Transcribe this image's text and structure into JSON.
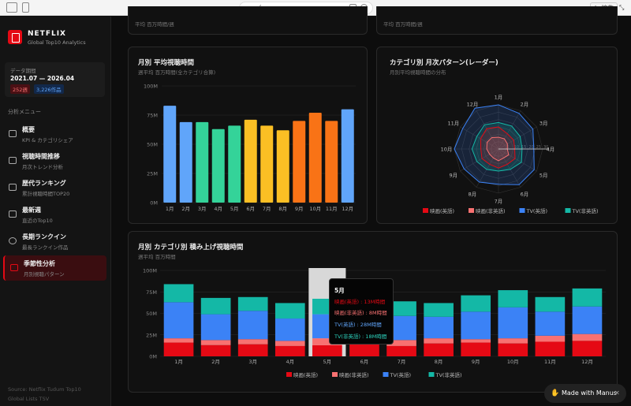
{
  "browser": {
    "url": "/",
    "edit_label": "編集"
  },
  "app": {
    "brand": "NETFLIX",
    "subtitle": "Global Top10 Analytics"
  },
  "period": {
    "label": "データ期間",
    "range": "2021.07 — 2026.04",
    "weeks": "252週",
    "titles": "3,226作品"
  },
  "menu": {
    "header": "分析メニュー",
    "items": [
      {
        "title": "概要",
        "sub": "KPI & カテゴリシェア",
        "icon": "bar-chart-icon"
      },
      {
        "title": "視聴時間推移",
        "sub": "月次トレンド分析",
        "icon": "trend-icon"
      },
      {
        "title": "歴代ランキング",
        "sub": "累計視聴時間TOP20",
        "icon": "trophy-icon"
      },
      {
        "title": "最新週",
        "sub": "直近のTop10",
        "icon": "calendar-icon"
      },
      {
        "title": "長期ランクイン",
        "sub": "最長ランクイン作品",
        "icon": "clock-icon"
      },
      {
        "title": "季節性分析",
        "sub": "月別視聴パターン",
        "icon": "wave-icon"
      }
    ]
  },
  "footer": {
    "line1": "Source: Netflix Tudum Top10",
    "line2": "Global Lists TSV"
  },
  "top_cards": {
    "left_sub": "平均 百万時間/週",
    "right_sub": "平均 百万時間/週"
  },
  "colors": {
    "movie_en": "#e50914",
    "movie_non": "#f87171",
    "tv_en": "#3b82f6",
    "tv_non": "#14b8a6"
  },
  "chart_data": [
    {
      "type": "bar",
      "title": "月別 平均視聴時間",
      "subtitle": "週平均 百万時間(全カテゴリ合算)",
      "categories": [
        "1月",
        "2月",
        "3月",
        "4月",
        "5月",
        "6月",
        "7月",
        "8月",
        "9月",
        "10月",
        "11月",
        "12月"
      ],
      "values": [
        83,
        69,
        69,
        63,
        66,
        71,
        66,
        62,
        70,
        77,
        70,
        80
      ],
      "bar_colors": [
        "#60a5fa",
        "#60a5fa",
        "#34d399",
        "#34d399",
        "#34d399",
        "#fbbf24",
        "#fbbf24",
        "#fbbf24",
        "#f97316",
        "#f97316",
        "#f97316",
        "#60a5fa"
      ],
      "yticks": [
        "0M",
        "25M",
        "50M",
        "75M",
        "100M"
      ],
      "ylim": [
        0,
        100
      ]
    },
    {
      "type": "radar",
      "title": "カテゴリ別 月次パターン(レーダー)",
      "subtitle": "月別平均視聴時間の分布",
      "categories": [
        "1月",
        "2月",
        "3月",
        "4月",
        "5月",
        "6月",
        "7月",
        "8月",
        "9月",
        "10月",
        "11月",
        "12月"
      ],
      "rticks": [
        "5",
        "10",
        "15",
        "20",
        "25",
        "30"
      ],
      "series": [
        {
          "name": "映画(英語)",
          "values": [
            15,
            12,
            12,
            11,
            13,
            12,
            13,
            12,
            13,
            12,
            14,
            16
          ]
        },
        {
          "name": "映画(非英語)",
          "values": [
            8,
            8,
            7,
            6,
            8,
            7,
            8,
            7,
            7,
            8,
            9,
            9
          ]
        },
        {
          "name": "TV(英語)",
          "values": [
            30,
            28,
            27,
            24,
            28,
            28,
            24,
            26,
            27,
            30,
            28,
            32
          ]
        },
        {
          "name": "TV(非英語)",
          "values": [
            18,
            18,
            17,
            16,
            18,
            16,
            15,
            16,
            17,
            18,
            17,
            19
          ]
        }
      ],
      "legend": "bottom"
    },
    {
      "type": "bar",
      "stacked": true,
      "title": "月別 カテゴリ別 積み上げ視聴時間",
      "subtitle": "週平均 百万時間",
      "categories": [
        "1月",
        "2月",
        "3月",
        "4月",
        "5月",
        "6月",
        "7月",
        "8月",
        "9月",
        "10月",
        "11月",
        "12月"
      ],
      "series": [
        {
          "name": "映画(英語)",
          "values": [
            16,
            13,
            14,
            12,
            13,
            14,
            12,
            15,
            16,
            15,
            17,
            18
          ]
        },
        {
          "name": "映画(非英語)",
          "values": [
            5,
            6,
            6,
            6,
            8,
            7,
            7,
            6,
            4,
            6,
            7,
            8
          ]
        },
        {
          "name": "TV(英語)",
          "values": [
            42,
            30,
            33,
            26,
            28,
            30,
            28,
            25,
            32,
            36,
            28,
            32
          ]
        },
        {
          "name": "TV(非英語)",
          "values": [
            21,
            19,
            16,
            18,
            18,
            19,
            17,
            16,
            19,
            20,
            17,
            21
          ]
        }
      ],
      "yticks": [
        "0M",
        "25M",
        "50M",
        "75M",
        "100M"
      ],
      "ylim": [
        0,
        100
      ],
      "tooltip": {
        "month": "5月",
        "lines": [
          "映画(英語) : 13M時間",
          "映画(非英語) : 8M時間",
          "TV(英語) : 28M時間",
          "TV(非英語) : 18M時間"
        ]
      }
    }
  ],
  "badge": {
    "label": "Made with Manus"
  }
}
